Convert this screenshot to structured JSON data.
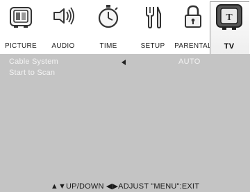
{
  "menu": {
    "tabs": [
      {
        "label": "PICTURE",
        "icon": "picture-icon"
      },
      {
        "label": "AUDIO",
        "icon": "audio-icon"
      },
      {
        "label": "TIME",
        "icon": "stopwatch-icon"
      },
      {
        "label": "SETUP",
        "icon": "tools-icon"
      },
      {
        "label": "PARENTAL",
        "icon": "padlock-icon"
      },
      {
        "label": "TV",
        "icon": "tv-icon"
      }
    ],
    "selected": "TV"
  },
  "settings": {
    "cable_system": {
      "label": "Cable System",
      "value": "AUTO"
    },
    "start_scan": {
      "label": "Start to Scan"
    }
  },
  "footer": {
    "hint": "▲▼UP/DOWN  ◀▶ADJUST  \"MENU\":EXIT"
  },
  "colors": {
    "panel": "#c4c4c4",
    "item_text": "#f4f4f4",
    "background": "#ffffff"
  }
}
